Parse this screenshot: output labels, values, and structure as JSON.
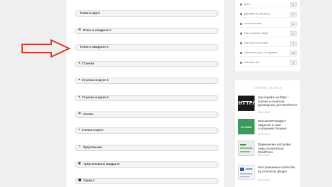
{
  "main": {
    "items": [
      {
        "icon": "",
        "label": "Плюс в круге"
      },
      {
        "icon": "⊞",
        "label": "Плюс в квадрате 1"
      },
      {
        "icon": "",
        "label": "Плюс в квадрате 2"
      },
      {
        "icon": "◂",
        "label": "Стрелка"
      },
      {
        "icon": "◂",
        "label": "Стрелка в круге 1"
      },
      {
        "icon": "◂",
        "label": "Стрелка в круге 2"
      },
      {
        "icon": "✚",
        "label": "Уголок"
      },
      {
        "icon": "◂",
        "label": "Уголок в круге"
      },
      {
        "icon": "↑",
        "label": "Треугольник"
      },
      {
        "icon": "◧",
        "label": "Треугольник в квадрате"
      },
      {
        "icon": "■",
        "label": "Папка 1"
      }
    ]
  },
  "sidebar": {
    "categories": [
      {
        "label": "БЛОГ",
        "count": "6"
      },
      {
        "label": "ДИЗАЙН ПОЛЕЗНОЕ",
        "count": "17"
      },
      {
        "label": "ПЛАГИНЫ/WP",
        "count": "8"
      },
      {
        "label": "НАСТРОЙКИ ВИКИ",
        "count": "6"
      },
      {
        "label": "ЧАЙ МОНОПОЛИЯ",
        "count": "4"
      },
      {
        "label": "ОБРАЗЦЫ ДЛЯ ПРОДАЖИ",
        "count": "16"
      },
      {
        "label": "ЭЛЕМЕНТЫ",
        "count": "3"
      }
    ],
    "recent_title": "СВЕЖИЕ ЗАПИСИ",
    "recent": [
      {
        "thumb_text": "HTTP/",
        "title": "Как перейти на https – полное и понятное руководство для WordPress",
        "date": "06.01.2023"
      },
      {
        "thumb_text": "PLUGIN",
        "title": "WoCLEVER Виджет закрытия в теме сообщения. Решено",
        "date": "03.01.2023"
      },
      {
        "thumb_text": "",
        "title": "Применение настройки темы ScreenPress WordPress",
        "date": "28.12.2022"
      },
      {
        "thumb_text": "",
        "title": "Настраиваемые Subscribe by comments (plugin)",
        "date": "25.12.2022"
      }
    ]
  }
}
